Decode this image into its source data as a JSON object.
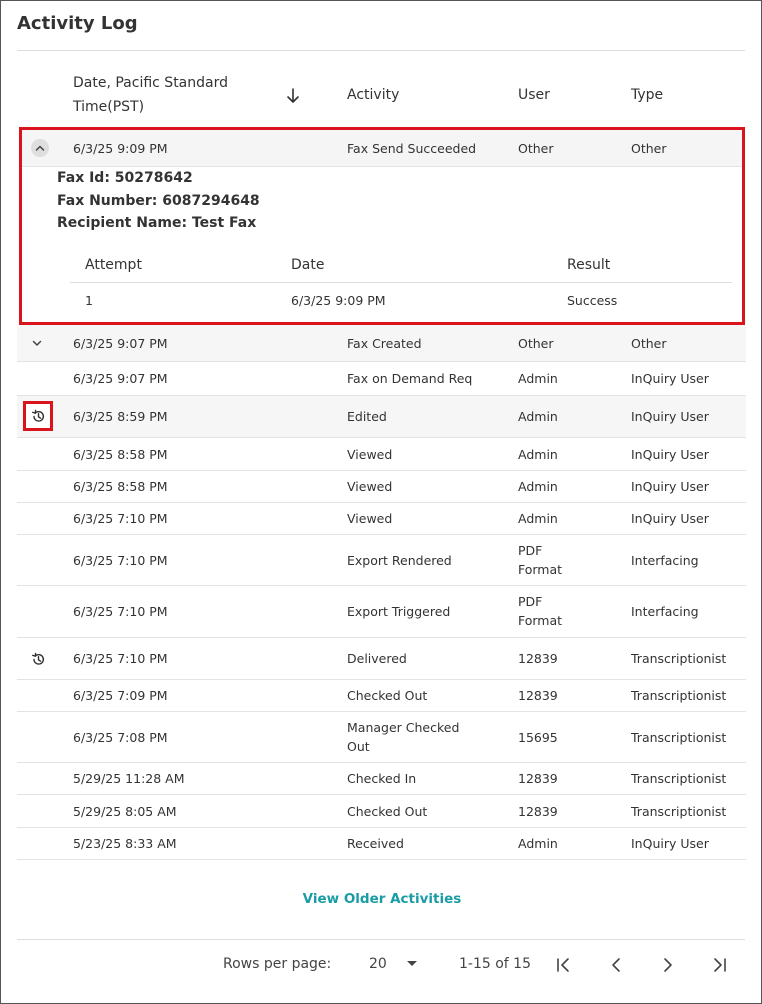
{
  "title": "Activity Log",
  "columns": {
    "date_line1": "Date, Pacific Standard",
    "date_line2": "Time(PST)",
    "activity": "Activity",
    "user": "User",
    "type": "Type"
  },
  "expanded": {
    "date": "6/3/25 9:09 PM",
    "activity": "Fax Send Succeeded",
    "user": "Other",
    "type": "Other",
    "fax_id": "Fax Id: 50278642",
    "fax_number": "Fax Number: 6087294648",
    "recipient": "Recipient Name: Test Fax",
    "sub_columns": {
      "attempt": "Attempt",
      "date": "Date",
      "result": "Result"
    },
    "sub_row": {
      "attempt": "1",
      "date": "6/3/25 9:09 PM",
      "result": "Success"
    }
  },
  "rows": [
    {
      "date": "6/3/25 9:07 PM",
      "activity": "Fax Created",
      "activity2": "",
      "user": "Other",
      "user2": "",
      "type": "Other",
      "icon": "chevron-down-icon"
    },
    {
      "date": "6/3/25 9:07 PM",
      "activity": "Fax on Demand Req",
      "activity2": "",
      "user": "Admin",
      "user2": "",
      "type": "InQuiry User",
      "icon": ""
    },
    {
      "date": "6/3/25 8:59 PM",
      "activity": "Edited",
      "activity2": "",
      "user": "Admin",
      "user2": "",
      "type": "InQuiry User",
      "icon": "history-icon"
    },
    {
      "date": "6/3/25 8:58 PM",
      "activity": "Viewed",
      "activity2": "",
      "user": "Admin",
      "user2": "",
      "type": "InQuiry User",
      "icon": ""
    },
    {
      "date": "6/3/25 8:58 PM",
      "activity": "Viewed",
      "activity2": "",
      "user": "Admin",
      "user2": "",
      "type": "InQuiry User",
      "icon": ""
    },
    {
      "date": "6/3/25 7:10 PM",
      "activity": "Viewed",
      "activity2": "",
      "user": "Admin",
      "user2": "",
      "type": "InQuiry User",
      "icon": ""
    },
    {
      "date": "6/3/25 7:10 PM",
      "activity": "Export Rendered",
      "activity2": "",
      "user": "PDF",
      "user2": "Format",
      "type": "Interfacing",
      "icon": ""
    },
    {
      "date": "6/3/25 7:10 PM",
      "activity": "Export Triggered",
      "activity2": "",
      "user": "PDF",
      "user2": "Format",
      "type": "Interfacing",
      "icon": ""
    },
    {
      "date": "6/3/25 7:10 PM",
      "activity": "Delivered",
      "activity2": "",
      "user": "12839",
      "user2": "",
      "type": "Transcriptionist",
      "icon": "history-icon"
    },
    {
      "date": "6/3/25 7:09 PM",
      "activity": "Checked Out",
      "activity2": "",
      "user": "12839",
      "user2": "",
      "type": "Transcriptionist",
      "icon": ""
    },
    {
      "date": "6/3/25 7:08 PM",
      "activity": "Manager Checked",
      "activity2": "Out",
      "user": "15695",
      "user2": "",
      "type": "Transcriptionist",
      "icon": ""
    },
    {
      "date": "5/29/25 11:28 AM",
      "activity": "Checked In",
      "activity2": "",
      "user": "12839",
      "user2": "",
      "type": "Transcriptionist",
      "icon": ""
    },
    {
      "date": "5/29/25 8:05 AM",
      "activity": "Checked Out",
      "activity2": "",
      "user": "12839",
      "user2": "",
      "type": "Transcriptionist",
      "icon": ""
    },
    {
      "date": "5/23/25 8:33 AM",
      "activity": "Received",
      "activity2": "",
      "user": "Admin",
      "user2": "",
      "type": "InQuiry User",
      "icon": ""
    }
  ],
  "view_older": "View Older Activities",
  "pagination": {
    "rows_per_page_label": "Rows per page:",
    "rows_per_page_value": "20",
    "range": "1-15 of 15"
  },
  "colors": {
    "highlight": "#d9141c",
    "link": "#1a9ca4"
  }
}
